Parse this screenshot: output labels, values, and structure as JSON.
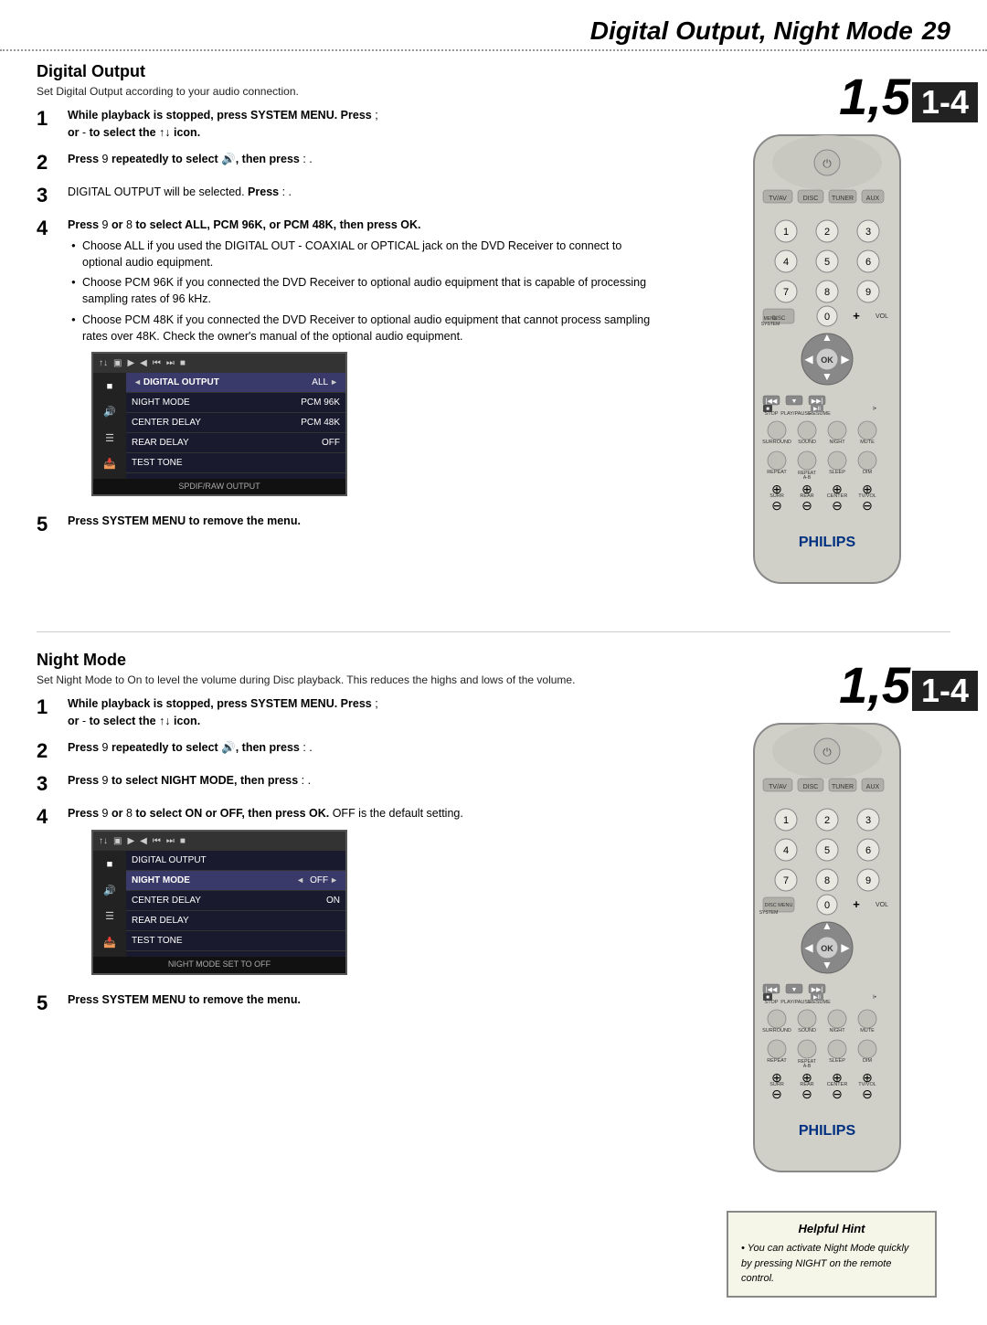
{
  "page": {
    "title": "Digital Output, Night Mode",
    "page_number": "29",
    "dotted_border": true
  },
  "digital_output": {
    "title": "Digital Output",
    "subtitle": "Set Digital Output according to your audio connection.",
    "steps": [
      {
        "number": "1",
        "text": "While playback is stopped, press SYSTEM MENU. Press ; or -  to select the  icon."
      },
      {
        "number": "2",
        "text": "Press 9  repeatedly to select , then press : ."
      },
      {
        "number": "3",
        "text": "DIGITAL OUTPUT will be selected. Press : ."
      },
      {
        "number": "4",
        "text": "Press 9  or 8  to select ALL, PCM 96K, or PCM 48K, then press OK.",
        "bullets": [
          "Choose ALL if you used the DIGITAL OUT - COAXIAL or OPTICAL jack on the DVD Receiver to connect to optional audio equipment.",
          "Choose PCM 96K if you connected the DVD Receiver to optional audio equipment that is capable of processing sampling rates of 96 kHz.",
          "Choose PCM 48K if you connected the DVD Receiver to optional audio equipment that cannot process sampling rates over 48K. Check the owner's manual of the optional audio equipment."
        ]
      },
      {
        "number": "5",
        "text": "Press SYSTEM MENU to remove the menu."
      }
    ],
    "menu": {
      "rows": [
        {
          "label": "DIGITAL OUTPUT",
          "value": "ALL",
          "highlighted": true
        },
        {
          "label": "NIGHT MODE",
          "value": "PCM 96K",
          "highlighted": false
        },
        {
          "label": "CENTER DELAY",
          "value": "PCM 48K",
          "highlighted": false
        },
        {
          "label": "REAR DELAY",
          "value": "OFF",
          "highlighted": false
        },
        {
          "label": "TEST TONE",
          "value": "",
          "highlighted": false
        }
      ],
      "footer": "SPDIF/RAW OUTPUT"
    },
    "badge_15": "1,5",
    "badge_14": "1-4"
  },
  "night_mode": {
    "title": "Night Mode",
    "subtitle": "Set Night Mode to On to level the volume during Disc playback. This reduces the highs and lows of the volume.",
    "steps": [
      {
        "number": "1",
        "text": "While playback is stopped, press SYSTEM MENU. Press ; or -  to select the  icon."
      },
      {
        "number": "2",
        "text": "Press 9  repeatedly to select , then press : ."
      },
      {
        "number": "3",
        "text": "Press 9  to select NIGHT MODE, then press : ."
      },
      {
        "number": "4",
        "text": "Press 9  or 8  to select ON or OFF, then press OK. OFF is the default setting."
      },
      {
        "number": "5",
        "text": "Press SYSTEM MENU to remove the menu."
      }
    ],
    "menu": {
      "rows": [
        {
          "label": "DIGITAL OUTPUT",
          "value": "",
          "highlighted": false
        },
        {
          "label": "NIGHT MODE",
          "value": "OFF",
          "highlighted": true
        },
        {
          "label": "CENTER DELAY",
          "value": "ON",
          "highlighted": false
        },
        {
          "label": "REAR DELAY",
          "value": "",
          "highlighted": false
        },
        {
          "label": "TEST TONE",
          "value": "",
          "highlighted": false
        }
      ],
      "footer": "NIGHT MODE SET TO OFF"
    },
    "badge_15": "1,5",
    "badge_14": "1-4"
  },
  "helpful_hint": {
    "title": "Helpful Hint",
    "text": "You can activate Night Mode quickly by pressing NIGHT on the remote control."
  },
  "remote": {
    "brand": "PHILIPS",
    "buttons": {
      "top_row": [
        "TV/AV",
        "DISC",
        "TUNER",
        "AUX"
      ],
      "num_row1": [
        "1",
        "2",
        "3"
      ],
      "num_row2": [
        "4",
        "5",
        "6"
      ],
      "num_row3": [
        "7",
        "8",
        "9"
      ],
      "num_row4": [
        "DISC MENU",
        "0",
        "+",
        "VOL"
      ],
      "control_labels": [
        "SURROUND",
        "SOUND",
        "NIGHT",
        "MUTE"
      ],
      "repeat_labels": [
        "REPEAT",
        "REPEAT A-B",
        "SLEEP",
        "DIM"
      ]
    }
  }
}
